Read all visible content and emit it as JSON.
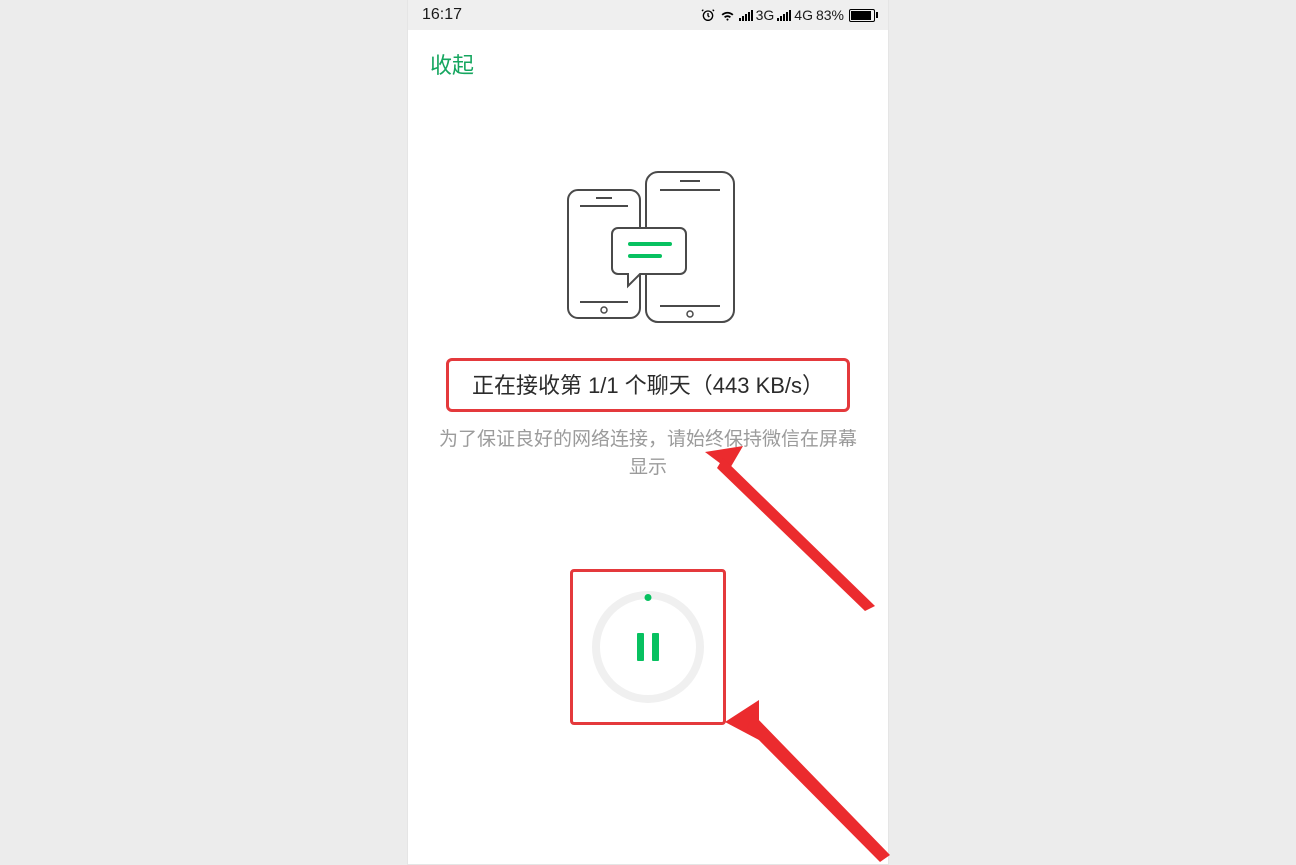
{
  "statusbar": {
    "time": "16:17",
    "net3g": "3G",
    "net4g": "4G",
    "battery_pct": "83%"
  },
  "top": {
    "collapse": "收起"
  },
  "main": {
    "status_text": "正在接收第 1/1 个聊天（443 KB/s）",
    "tip_text": "为了保证良好的网络连接，请始终保持微信在屏幕显示"
  },
  "icons": {
    "alarm": "alarm-icon",
    "wifi": "wifi-icon",
    "signal1": "signal-icon",
    "signal2": "signal-icon",
    "battery": "battery-icon",
    "phones": "phones-transfer-icon",
    "pause": "pause-icon"
  },
  "colors": {
    "accent_green": "#07c160",
    "annotation_red": "#e4393c"
  }
}
